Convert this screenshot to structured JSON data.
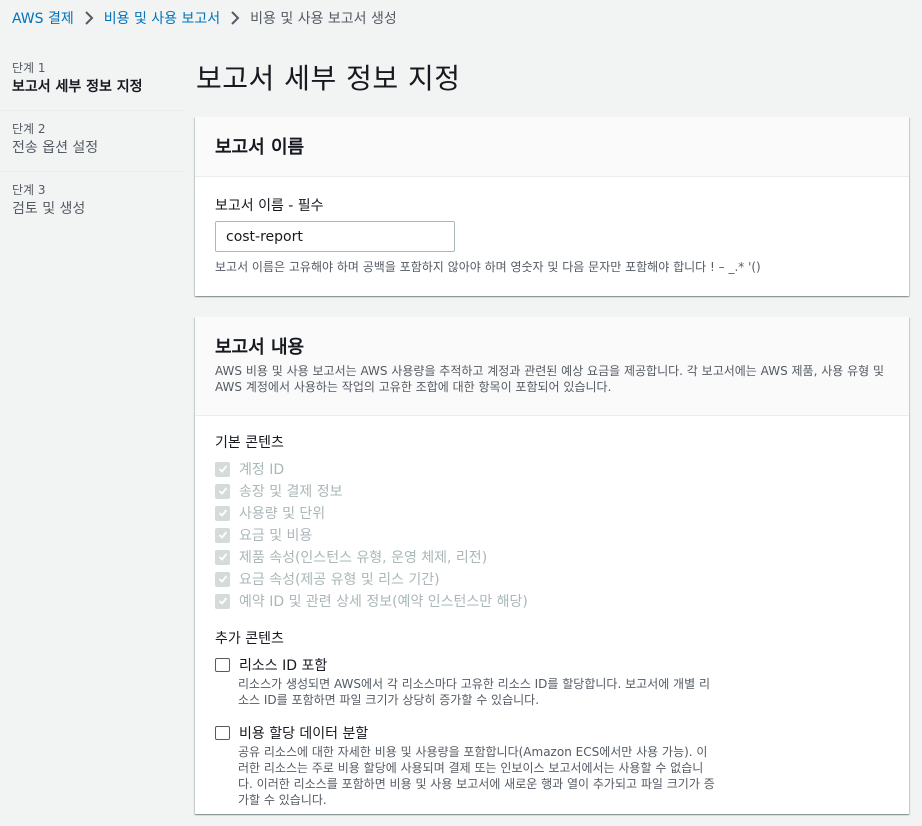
{
  "breadcrumb": {
    "items": [
      "AWS 결제",
      "비용 및 사용 보고서",
      "비용 및 사용 보고서 생성"
    ]
  },
  "steps": [
    {
      "num": "단계 1",
      "title": "보고서 세부 정보 지정",
      "active": true
    },
    {
      "num": "단계 2",
      "title": "전송 옵션 설정",
      "active": false
    },
    {
      "num": "단계 3",
      "title": "검토 및 생성",
      "active": false
    }
  ],
  "page_title": "보고서 세부 정보 지정",
  "report_name_panel": {
    "title": "보고서 이름",
    "field_label": "보고서 이름 - 필수",
    "value": "cost-report",
    "hint": "보고서 이름은 고유해야 하며 공백을 포함하지 않아야 하며 영숫자 및 다음 문자만 포함해야 합니다 ! – _.* '()"
  },
  "report_content_panel": {
    "title": "보고서 내용",
    "description": "AWS 비용 및 사용 보고서는 AWS 사용량을 추적하고 계정과 관련된 예상 요금을 제공합니다. 각 보고서에는 AWS 제품, 사용 유형 및 AWS 계정에서 사용하는 작업의 고유한 조합에 대한 항목이 포함되어 있습니다.",
    "default_label": "기본 콘텐츠",
    "default_items": [
      "계정 ID",
      "송장 및 결제 정보",
      "사용량 및 단위",
      "요금 및 비용",
      "제품 속성(인스턴스 유형, 운영 체제, 리전)",
      "요금 속성(제공 유형 및 리스 기간)",
      "예약 ID 및 관련 상세 정보(예약 인스턴스만 해당)"
    ],
    "additional_label": "추가 콘텐츠",
    "additional_items": [
      {
        "label": "리소스 ID 포함",
        "checked": false,
        "description": "리소스가 생성되면 AWS에서 각 리소스마다 고유한 리소스 ID를 할당합니다. 보고서에 개별 리소스 ID를 포함하면 파일 크기가 상당히 증가할 수 있습니다."
      },
      {
        "label": "비용 할당 데이터 분할",
        "checked": false,
        "description": "공유 리소스에 대한 자세한 비용 및 사용량을 포함합니다(Amazon ECS에서만 사용 가능). 이러한 리소스는 주로 비용 할당에 사용되며 결제 또는 인보이스 보고서에서는 사용할 수 없습니다. 이러한 리소스를 포함하면 비용 및 사용 보고서에 새로운 행과 열이 추가되고 파일 크기가 증가할 수 있습니다."
      }
    ]
  }
}
